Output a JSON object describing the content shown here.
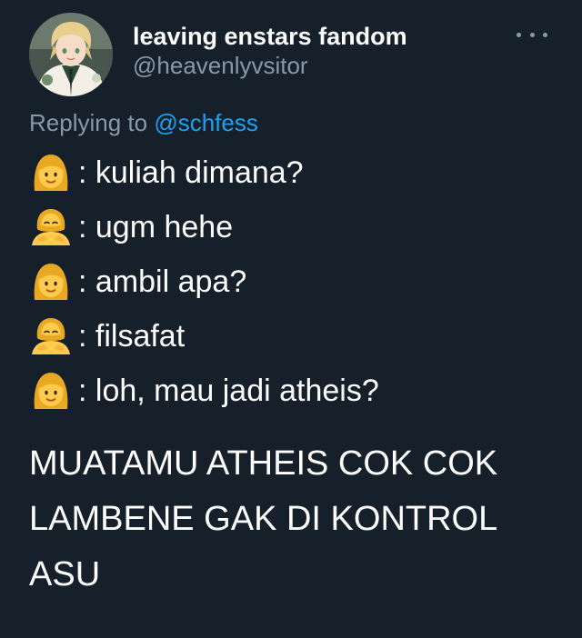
{
  "tweet": {
    "display_name": "leaving enstars fandom",
    "handle": "@heavenlyvsitor",
    "more_icon": "more-horizontal-icon",
    "replying_prefix": "Replying to ",
    "replying_mention": "@schfess"
  },
  "conversation": [
    {
      "speaker_icon": "woman-emoji",
      "text": ": kuliah dimana?"
    },
    {
      "speaker_icon": "person-bowing-emoji",
      "text": ": ugm hehe"
    },
    {
      "speaker_icon": "woman-emoji",
      "text": ": ambil apa?"
    },
    {
      "speaker_icon": "person-bowing-emoji",
      "text": ": filsafat"
    },
    {
      "speaker_icon": "woman-emoji",
      "text": ": loh, mau jadi atheis?"
    }
  ],
  "closing_lines": [
    "MUATAMU ATHEIS COK COK",
    "LAMBENE GAK DI KONTROL",
    "ASU"
  ],
  "colors": {
    "background": "#15202b",
    "text": "#ffffff",
    "muted": "#8899a6",
    "accent": "#1da1f2"
  }
}
